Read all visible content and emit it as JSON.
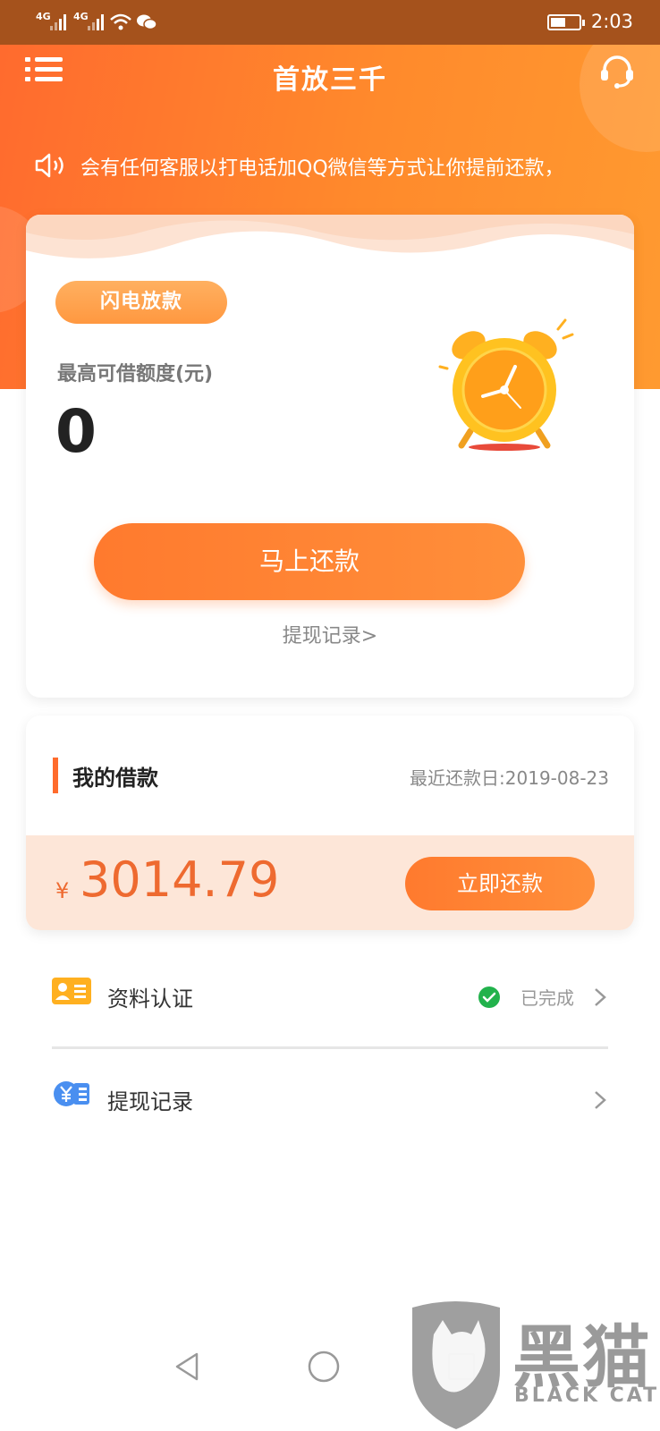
{
  "status_bar": {
    "sim1": "4G",
    "sim2": "4G",
    "time": "2:03"
  },
  "header": {
    "title": "首放三千",
    "menu_icon": "menu-icon",
    "support_icon": "headset-icon"
  },
  "notice": {
    "icon": "speaker-icon",
    "text": "会有任何客服以打电话加QQ微信等方式让你提前还款，"
  },
  "main_card": {
    "tag": "闪电放款",
    "limit_label": "最高可借额度(元)",
    "limit_value": "0",
    "illustration": "alarm-clock",
    "repay_button": "马上还款",
    "withdraw_link": "提现记录>"
  },
  "loan_card": {
    "title": "我的借款",
    "recent_date": "最近还款日:2019-08-23",
    "currency": "¥",
    "amount": "3014.79",
    "repay_now_button": "立即还款"
  },
  "list": [
    {
      "label": "资料认证",
      "status": "已完成",
      "icon": "id-card-icon"
    },
    {
      "label": "提现记录",
      "status": "",
      "icon": "yuan-record-icon"
    }
  ],
  "watermark": {
    "main": "黑猫",
    "sub": "BLACK CAT"
  },
  "colors": {
    "accent": "#ff7a2e",
    "status_green": "#22b24c",
    "amount": "#ee6a30"
  }
}
